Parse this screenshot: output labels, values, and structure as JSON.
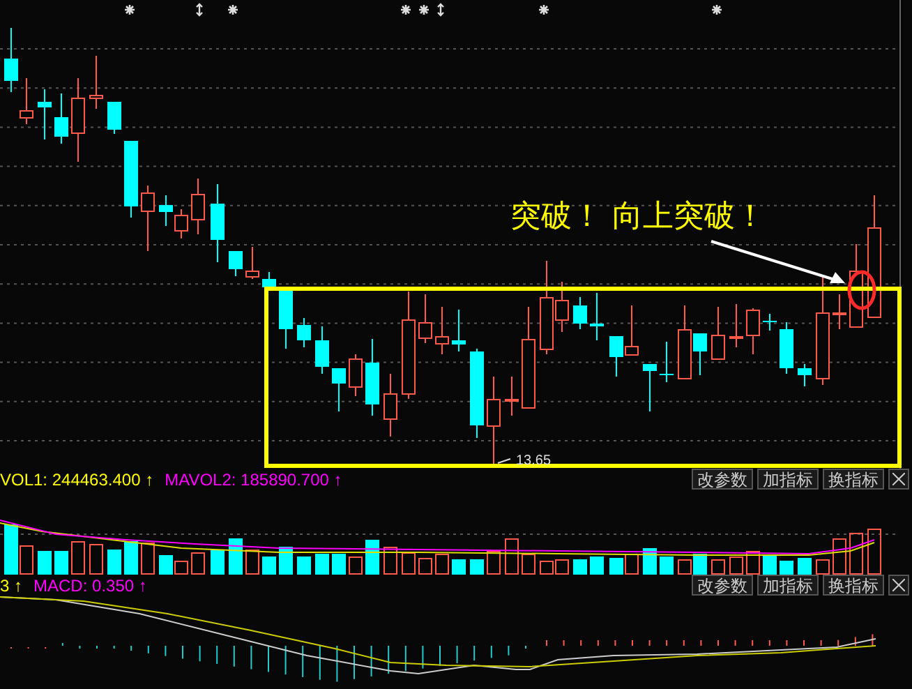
{
  "main_chart": {
    "annotation": "突破！ 向上突破！",
    "low_price_label": "13.65"
  },
  "panels": [
    {
      "kind": "volume",
      "indicators": [
        {
          "text": "VOL1: 244463.400 ↑",
          "color": "#ffff00"
        },
        {
          "text": "MAVOL2: 185890.700 ↑",
          "color": "#ff00ff"
        }
      ],
      "buttons": [
        "改参数",
        "加指标",
        "换指标"
      ]
    },
    {
      "kind": "macd",
      "indicators": [
        {
          "text": "3 ↑",
          "color": "#ffff00"
        },
        {
          "text": "MACD: 0.350 ↑",
          "color": "#ff00ff"
        }
      ],
      "buttons": [
        "改参数",
        "加指标",
        "换指标"
      ]
    }
  ]
}
